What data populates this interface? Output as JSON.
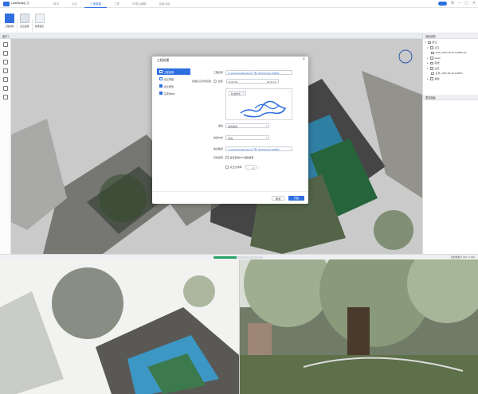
{
  "app": {
    "name": "LixelStudio",
    "brand": "云控"
  },
  "menu": [
    "首页",
    "点云",
    "三维重建",
    "工具",
    "可视化编辑",
    "高级功能"
  ],
  "menu_active_index": 2,
  "toolbar": [
    {
      "label": "工程处理",
      "icon": "process-icon",
      "color": "#2f6fe0"
    },
    {
      "label": "点云处理",
      "icon": "cloud-icon",
      "color": "#9aa6b5"
    },
    {
      "label": "效果预览",
      "icon": "preview-icon",
      "color": "#b8c0cc"
    }
  ],
  "viewbar": {
    "label": "窗口1"
  },
  "right_panel": {
    "title": "场景结构",
    "tree": [
      {
        "label": "默认",
        "level": 0
      },
      {
        "label": "点云",
        "level": 1
      },
      {
        "label": "SGR_2020-06-30-102854.las",
        "level": 2
      },
      {
        "label": "Mesh",
        "level": 1
      },
      {
        "label": "轨迹",
        "level": 1
      },
      {
        "label": "全景",
        "level": 1
      },
      {
        "label": "全景_2020-06-30-102854",
        "level": 2
      },
      {
        "label": "其他",
        "level": 1
      }
    ],
    "props_title": "属性面板"
  },
  "status": {
    "text": "当前数据 0.000 / 0.000",
    "progress": 0.46
  },
  "dialog": {
    "title": "工程处理",
    "nav": [
      {
        "label": "工程设置",
        "active": true
      },
      {
        "label": "点云拼接",
        "active": false
      },
      {
        "label": "点云着色",
        "active": false
      },
      {
        "label": "生成Mesh",
        "active": false
      }
    ],
    "fields": {
      "project_label": "工程目录",
      "project_value": "C:/Users/lixel/Desktop/工程_2020-06-30-102854",
      "data_label": "处理点云时间范围",
      "data_value": "全部",
      "range_start": "00:00:00",
      "range_end": "00:00:00",
      "map_select": "轨迹预览",
      "color_label": "着色",
      "color_value": "最优着色",
      "mode_label": "拼接方式",
      "mode_value": "手动",
      "output_label": "输出路径",
      "output_value": "C:/Users/lixel/Desktop/工程_2020-06-30-102854",
      "adv_label": "高级选项",
      "adv_option": "是否使用RTK辅助解算",
      "filter_label": "点云分辨率",
      "filter_value": "2"
    },
    "buttons": {
      "cancel": "取消",
      "ok": "开始"
    }
  }
}
